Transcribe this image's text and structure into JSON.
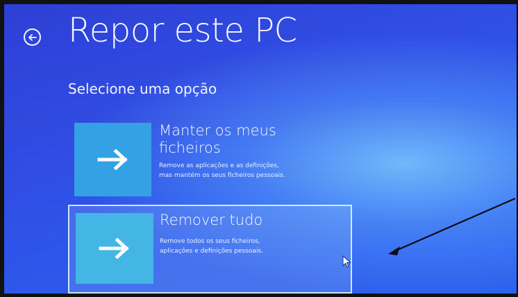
{
  "header": {
    "title": "Repor este PC"
  },
  "main": {
    "subtitle": "Selecione uma opção"
  },
  "options": [
    {
      "title_line1": "Manter os meus",
      "title_line2": "ficheiros",
      "description_line1": "Remove as aplicações e as definições,",
      "description_line2": "mas mantém os seus ficheiros pessoais.",
      "icon": "arrow-right-icon"
    },
    {
      "title_line1": "Remover tudo",
      "description_line1": "Remove todos os seus ficheiros,",
      "description_line2": "aplicações e definições pessoais.",
      "icon": "arrow-right-icon"
    }
  ],
  "colors": {
    "background": "#2e4be3",
    "tile_primary": "#34a1e4",
    "tile_selected": "#43b6e6",
    "text": "#f5f8ff"
  },
  "icons": {
    "back": "back-arrow-circle-icon",
    "cursor": "mouse-cursor-icon",
    "annotation": "annotation-arrow-icon"
  }
}
